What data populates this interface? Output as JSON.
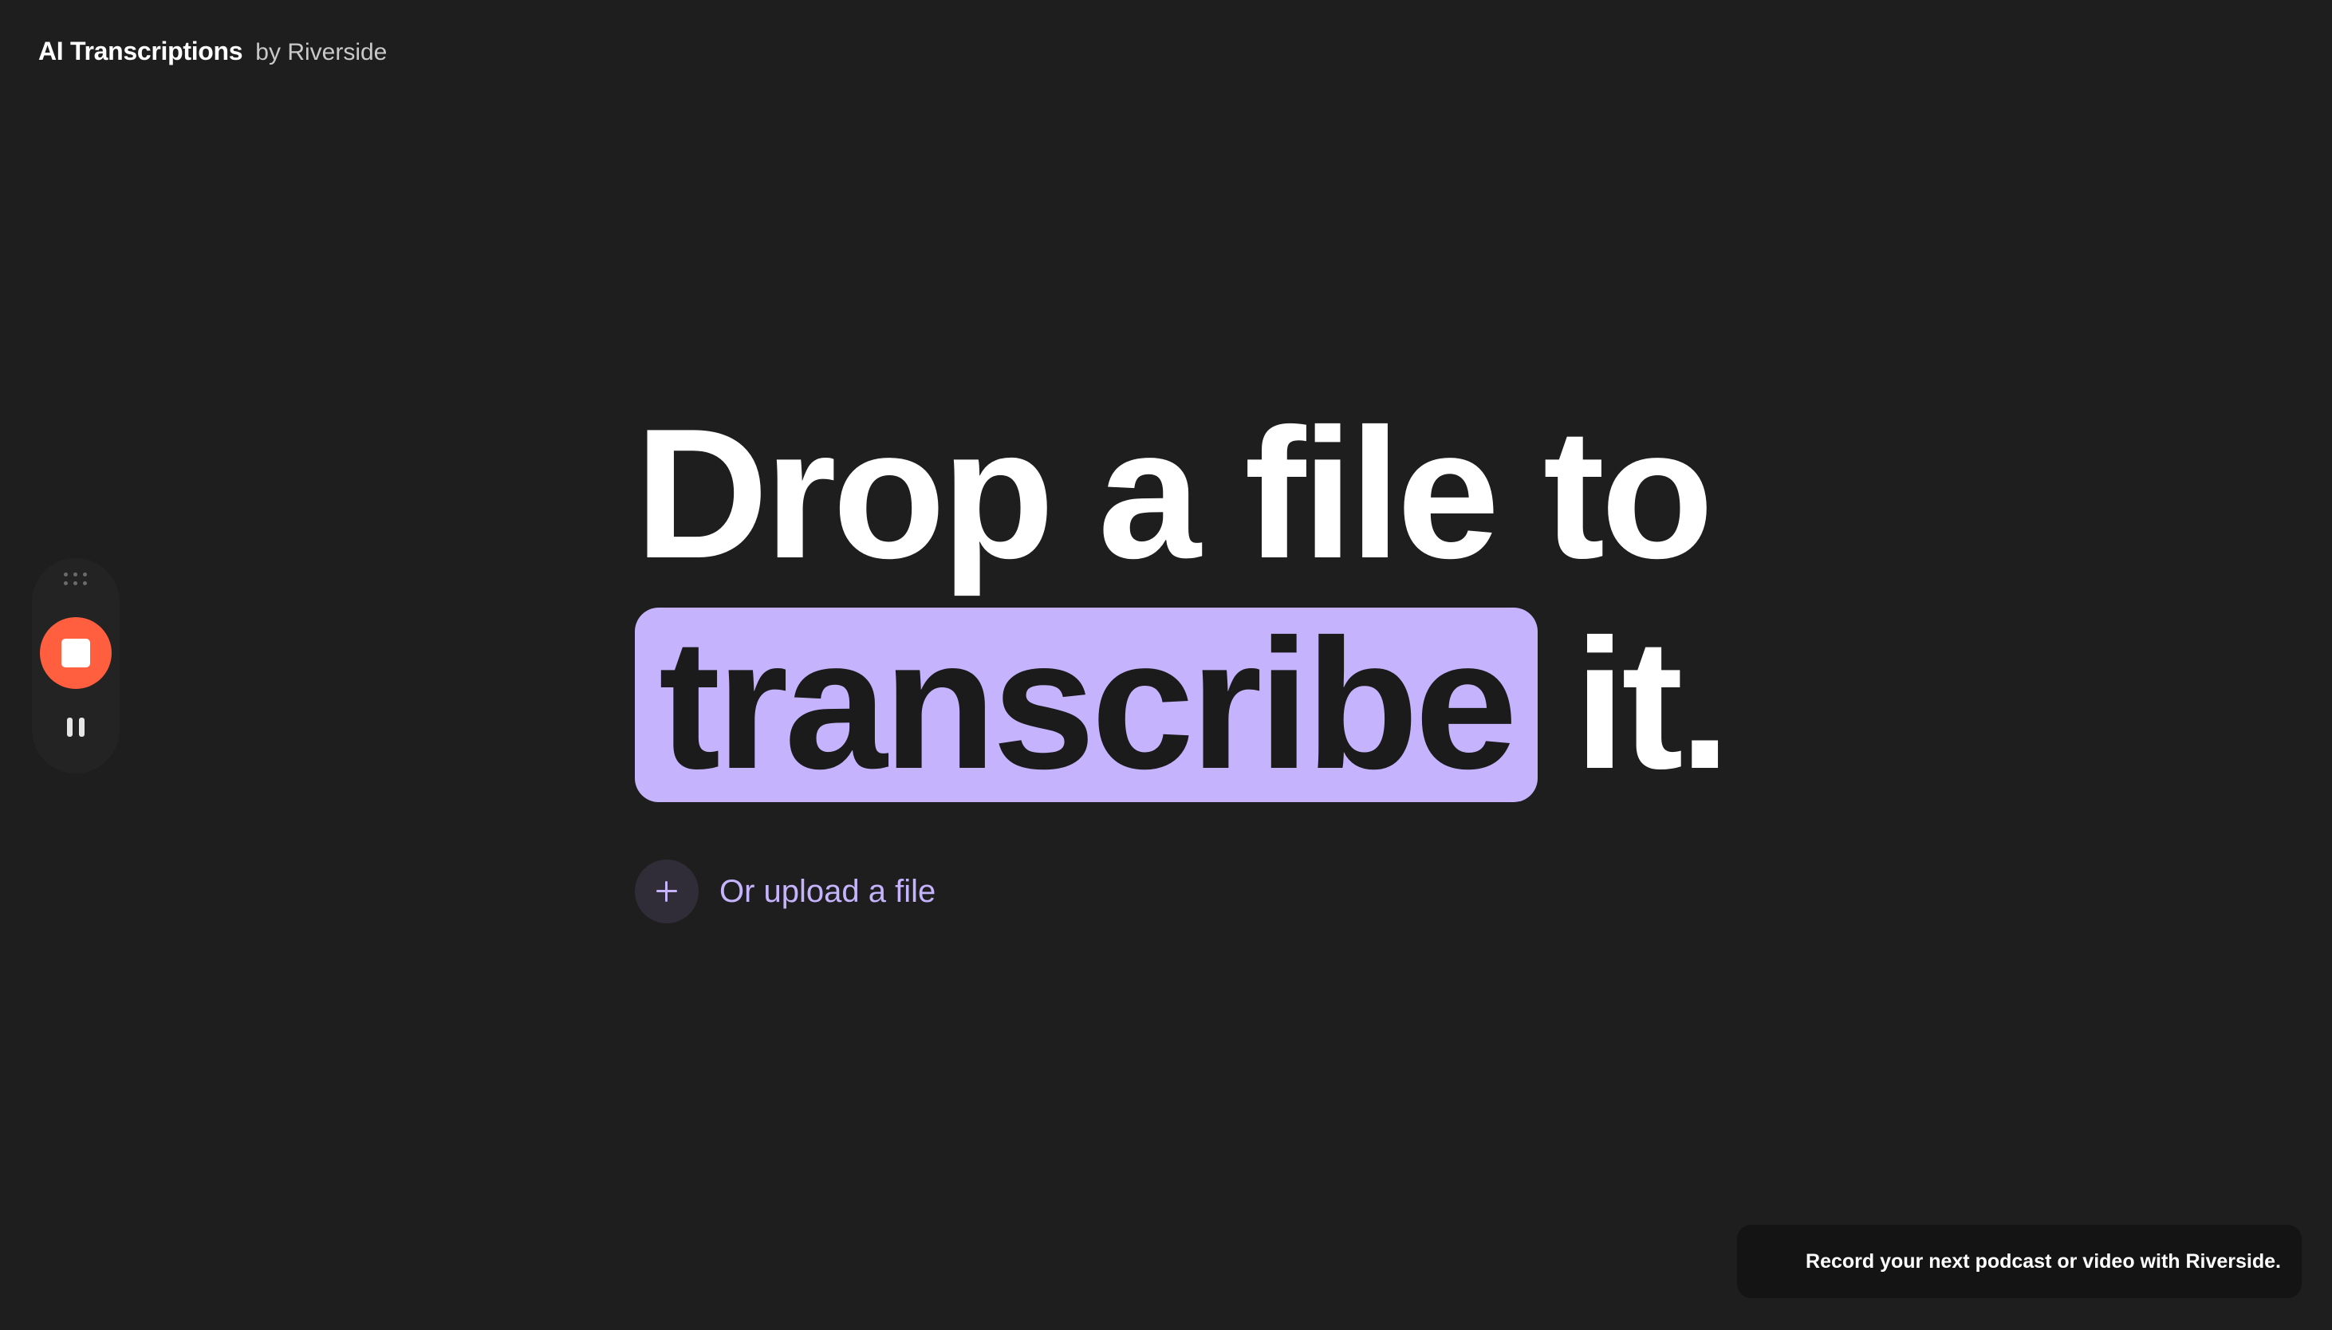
{
  "header": {
    "title": "AI Transcriptions",
    "byline": "by Riverside"
  },
  "recorder": {
    "drag_icon": "drag-handle-icon",
    "stop_icon": "stop-icon",
    "pause_icon": "pause-icon",
    "stop_color": "#ff5f3f"
  },
  "hero": {
    "line1": "Drop a file to",
    "highlight_word": "transcribe",
    "end_text": "it.",
    "highlight_color": "#c5b3fd"
  },
  "upload": {
    "icon": "plus-icon",
    "label": "Or upload a file"
  },
  "promo": {
    "text": "Record your next podcast or video with Riverside."
  },
  "colors": {
    "background": "#1e1e1e",
    "accent": "#c5b3fd"
  }
}
